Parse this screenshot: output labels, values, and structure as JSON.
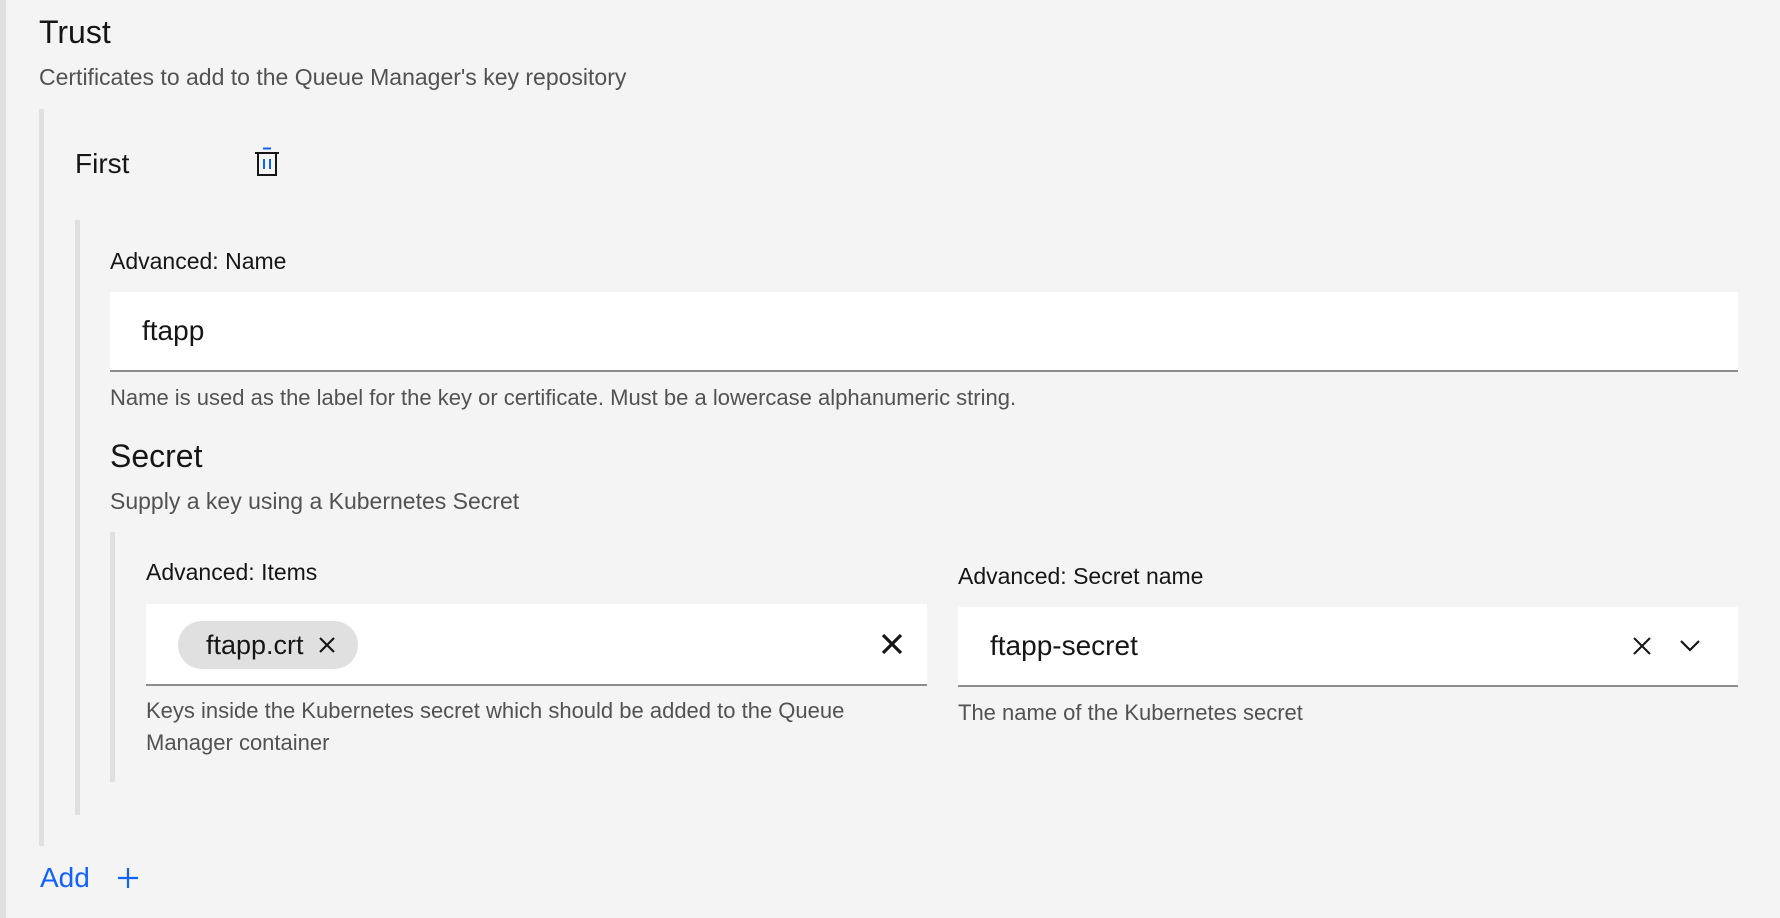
{
  "trust": {
    "title": "Trust",
    "description": "Certificates to add to the Queue Manager's key repository",
    "add_label": "Add",
    "add_icon": "plus-icon"
  },
  "item": {
    "title": "First",
    "delete_icon": "trash-can-icon",
    "name_field": {
      "label": "Advanced: Name",
      "value": "ftapp",
      "helper": "Name is used as the label for the key or certificate. Must be a lowercase alphanumeric string."
    },
    "secret": {
      "title": "Secret",
      "description": "Supply a key using a Kubernetes Secret",
      "items_field": {
        "label": "Advanced: Items",
        "tags": [
          "ftapp.crt"
        ],
        "helper": "Keys inside the Kubernetes secret which should be added to the Queue Manager container",
        "clear_icon": "close-icon"
      },
      "secret_name_field": {
        "label": "Advanced: Secret name",
        "value": "ftapp-secret",
        "helper": "The name of the Kubernetes secret",
        "clear_icon": "close-icon",
        "dropdown_icon": "chevron-down-icon"
      }
    }
  },
  "colors": {
    "background": "#f4f4f4",
    "field_background": "#ffffff",
    "link": "#0f62fe",
    "nesting_bar": "#e0e0e0",
    "tag_background": "#e0e0e0"
  }
}
